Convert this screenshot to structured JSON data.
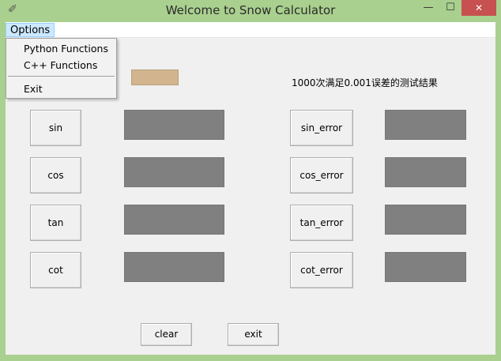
{
  "window": {
    "title": "Welcome to Snow Calculator",
    "app_icon": "feather-icon",
    "controls": {
      "minimize": "—",
      "maximize": "☐",
      "close": "✕"
    }
  },
  "menubar": {
    "options_label": "Options",
    "dropdown": {
      "items": [
        "Python Functions",
        "C++ Functions",
        "Exit"
      ]
    }
  },
  "tolerance": {
    "colon": ":",
    "field_color": "#d2b58e"
  },
  "result_label": "1000次满足0.001误差的测试结果",
  "functions": [
    {
      "button": "sin",
      "error_button": "sin_error"
    },
    {
      "button": "cos",
      "error_button": "cos_error"
    },
    {
      "button": "tan",
      "error_button": "tan_error"
    },
    {
      "button": "cot",
      "error_button": "cot_error"
    }
  ],
  "bottom": {
    "clear_label": "clear",
    "exit_label": "exit"
  },
  "colors": {
    "frame": "#a9d08e",
    "client_bg": "#f0f0f0",
    "output_box": "#808080",
    "close_button": "#c75050"
  }
}
